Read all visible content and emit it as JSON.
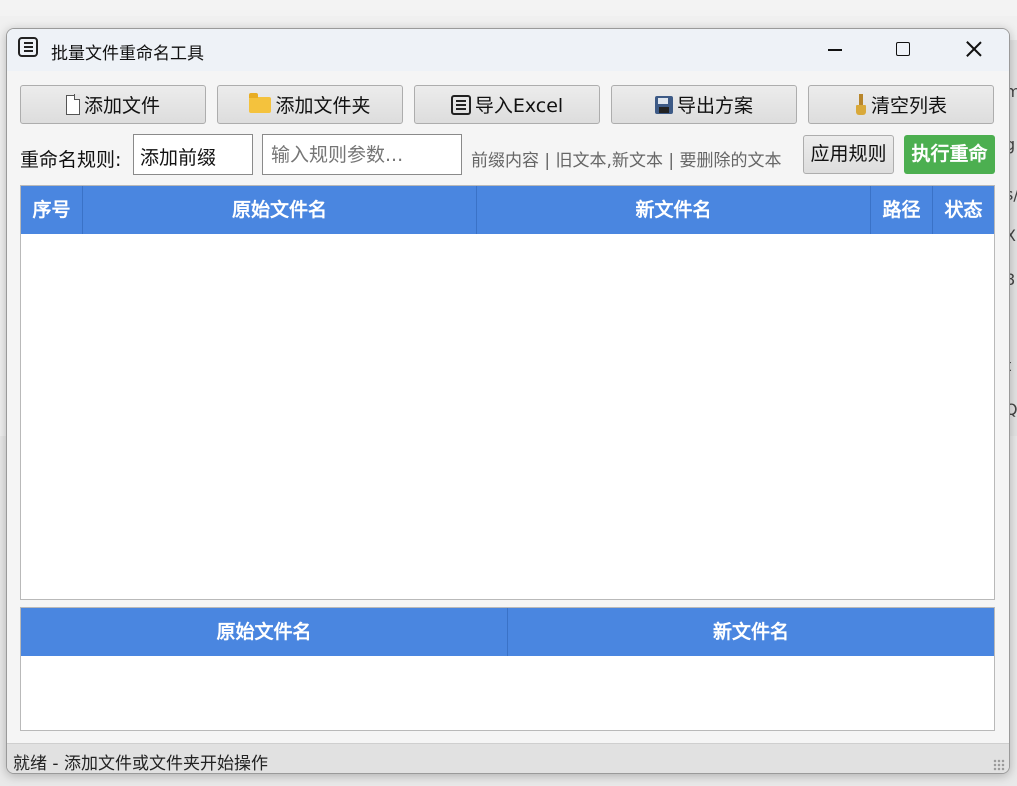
{
  "window": {
    "title": "批量文件重命名工具"
  },
  "toolbar": {
    "add_file": "添加文件",
    "add_folder": "添加文件夹",
    "import_excel": "导入Excel",
    "export_plan": "导出方案",
    "clear_list": "清空列表"
  },
  "rule": {
    "label": "重命名规则:",
    "selected": "添加前缀",
    "placeholder": "输入规则参数...",
    "hint": "前缀内容 | 旧文本,新文本 | 要删除的文本",
    "apply": "应用规则",
    "execute": "执行重命",
    "execute_color": "#4caf50"
  },
  "main_table": {
    "columns": [
      "序号",
      "原始文件名",
      "新文件名",
      "路径",
      "状态"
    ],
    "header_color": "#4a86e0",
    "rows": []
  },
  "preview_table": {
    "columns": [
      "原始文件名",
      "新文件名"
    ],
    "rows": []
  },
  "status_bar": {
    "text": "就绪 - 添加文件或文件夹开始操作"
  },
  "background": {
    "fragments": [
      "m",
      "g",
      "s/",
      "X",
      "8",
      "]",
      "t",
      "Q1"
    ]
  }
}
